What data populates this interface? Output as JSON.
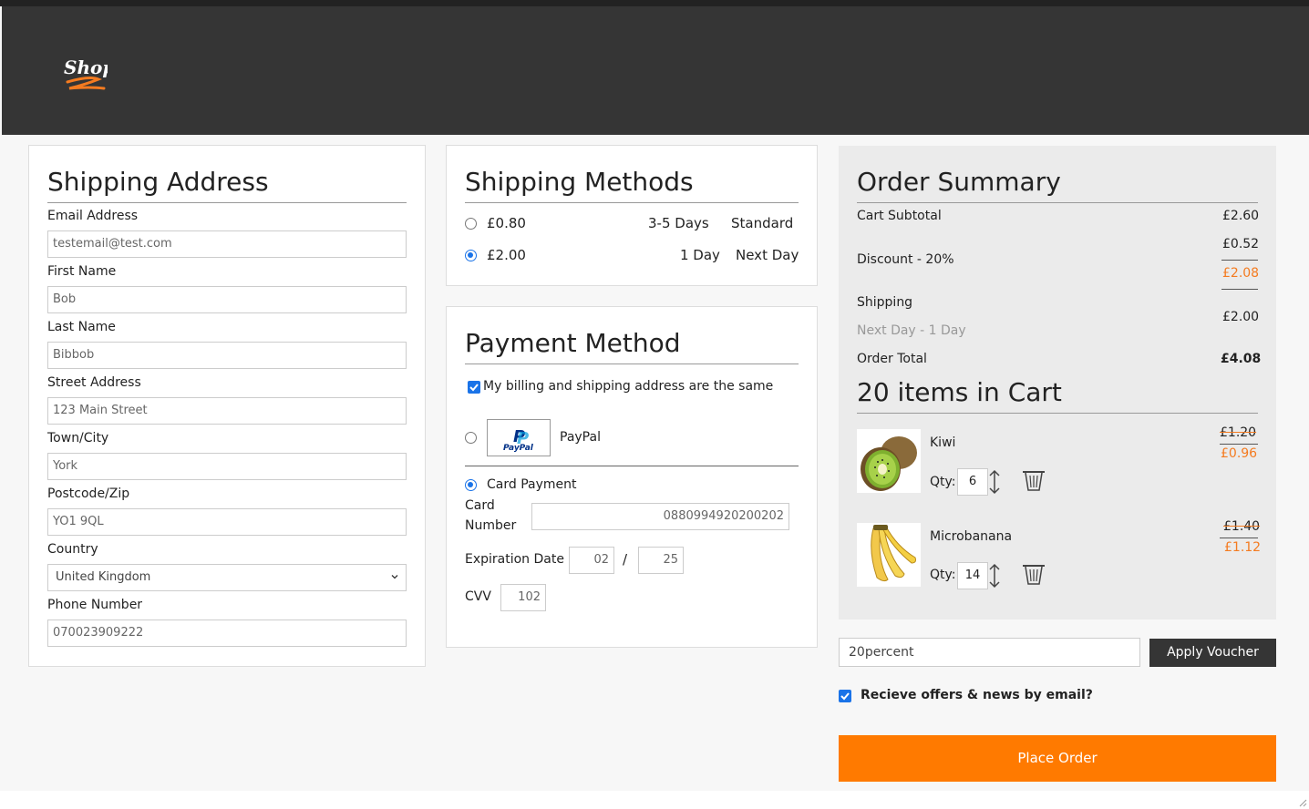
{
  "brand": {
    "logo_text": "Shop",
    "accent": "#f47b20"
  },
  "shipping_address": {
    "title": "Shipping Address",
    "fields": [
      {
        "label": "Email Address",
        "value": "testemail@test.com"
      },
      {
        "label": "First Name",
        "value": "Bob"
      },
      {
        "label": "Last Name",
        "value": "Bibbob"
      },
      {
        "label": "Street Address",
        "value": "123 Main Street"
      },
      {
        "label": "Town/City",
        "value": "York"
      },
      {
        "label": "Postcode/Zip",
        "value": "YO1 9QL"
      },
      {
        "label": "Country",
        "value": "United Kingdom"
      },
      {
        "label": "Phone Number",
        "value": "070023909222"
      }
    ]
  },
  "shipping_methods": {
    "title": "Shipping Methods",
    "options": [
      {
        "price": "£0.80",
        "time": "3-5 Days",
        "name": "Standard",
        "selected": false
      },
      {
        "price": "£2.00",
        "time": "1 Day",
        "name": "Next Day",
        "selected": true
      }
    ]
  },
  "payment_method": {
    "title": "Payment Method",
    "same_address_label": "My billing and shipping address are the same",
    "paypal_label": "PayPal",
    "paypal_logo_text": "PayPal",
    "card_label": "Card Payment",
    "card_number_label_1": "Card",
    "card_number_label_2": "Number",
    "card_number": "0880994920200202",
    "expiration_label": "Expiration Date",
    "exp_month": "02",
    "exp_separator": "/",
    "exp_year": "25",
    "cvv_label": "CVV",
    "cvv": "102"
  },
  "order_summary": {
    "title": "Order Summary",
    "subtotal_label": "Cart Subtotal",
    "subtotal": "£2.60",
    "discount_label": "Discount - 20%",
    "discount_amount": "£0.52",
    "discounted_total": "£2.08",
    "shipping_label": "Shipping",
    "shipping_detail": "Next Day - 1 Day",
    "shipping_cost": "£2.00",
    "total_label": "Order Total",
    "total": "£4.08",
    "cart_heading": "20 items in Cart",
    "qty_label": "Qty:",
    "items": [
      {
        "name": "Kiwi",
        "qty": "6",
        "old_price": "£1.20",
        "new_price": "£0.96"
      },
      {
        "name": "Microbanana",
        "qty": "14",
        "old_price": "£1.40",
        "new_price": "£1.12"
      }
    ]
  },
  "voucher": {
    "value": "20percent",
    "button_label": "Apply Voucher"
  },
  "newsletter_label": "Recieve offers & news by email?",
  "place_order_label": "Place Order"
}
